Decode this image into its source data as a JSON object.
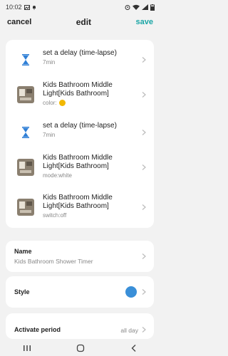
{
  "status": {
    "time": "10:02"
  },
  "nav": {
    "cancel": "cancel",
    "title": "edit",
    "save": "save"
  },
  "steps": [
    {
      "type": "delay",
      "title": "set a delay (time-lapse)",
      "sub": "7min"
    },
    {
      "type": "device",
      "title": "Kids Bathroom Middle Light[Kids Bathroom]",
      "sub": "color:",
      "color_swatch": "#f2b800"
    },
    {
      "type": "delay",
      "title": "set a delay (time-lapse)",
      "sub": "7min"
    },
    {
      "type": "device",
      "title": "Kids Bathroom Middle Light[Kids Bathroom]",
      "sub": "mode:white"
    },
    {
      "type": "device",
      "title": "Kids Bathroom Middle Light[Kids Bathroom]",
      "sub": "switch:off"
    }
  ],
  "name_row": {
    "label": "Name",
    "value": "Kids Bathroom Shower Timer"
  },
  "style_row": {
    "label": "Style",
    "color": "#3a8fd8"
  },
  "period_row": {
    "label": "Activate period",
    "value": "all day"
  },
  "colors": {
    "accent": "#1aa6a6",
    "icon_blue": "#2f7fd6"
  }
}
